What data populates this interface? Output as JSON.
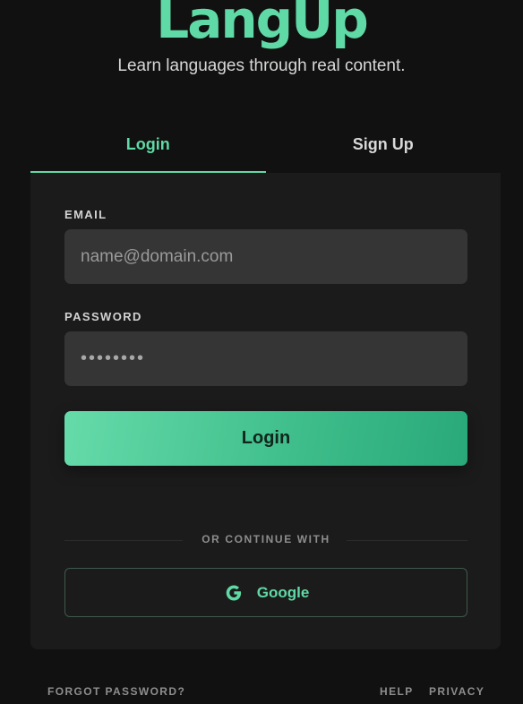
{
  "app": {
    "brand": "LangUp",
    "tagline": "Learn languages through real content."
  },
  "tabs": [
    {
      "label": "Login",
      "active": true
    },
    {
      "label": "Sign Up",
      "active": false
    }
  ],
  "form": {
    "email": {
      "label": "EMAIL",
      "placeholder": "name@domain.com",
      "value": ""
    },
    "password": {
      "label": "PASSWORD",
      "placeholder": "••••••••",
      "value": ""
    },
    "submit_label": "Login"
  },
  "divider": {
    "text": "OR CONTINUE WITH"
  },
  "social": {
    "google_label": "Google",
    "icon": "google-icon"
  },
  "footer": {
    "forgot_password": "FORGOT PASSWORD?",
    "help": "HELP",
    "privacy": "PRIVACY"
  },
  "colors": {
    "accent": "#5fd9a5",
    "background": "#111111",
    "card": "#1b1b1b",
    "input": "#353535"
  }
}
